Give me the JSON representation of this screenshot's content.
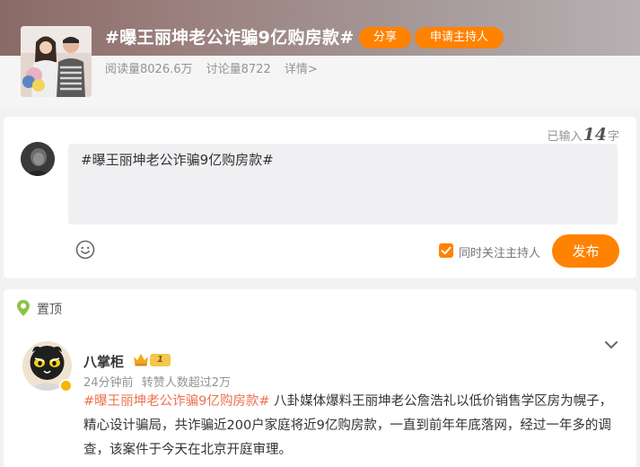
{
  "topic": {
    "title": "#曝王丽坤老公诈骗9亿购房款#",
    "share_label": "分享",
    "apply_host_label": "申请主持人",
    "read_count": "阅读量8026.6万",
    "discuss_count": "讨论量8722",
    "detail_link": "详情>"
  },
  "composer": {
    "char_count_prefix": "已输入",
    "char_count_value": "14",
    "char_count_suffix": "字",
    "input_value": "#曝王丽坤老公诈骗9亿购房款#",
    "follow_host_label": "同时关注主持人",
    "follow_host_checked": true,
    "publish_label": "发布"
  },
  "pinned_post": {
    "pin_label": "置顶",
    "author_name": "八掌柜",
    "level": "1",
    "time": "24分钟前",
    "repost_info": "转赞人数超过2万",
    "hashtag": "#曝王丽坤老公诈骗9亿购房款#",
    "body_text": " 八卦媒体爆料王丽坤老公詹浩礼以低价销售学区房为幌子，精心设计骗局，共诈骗近200户家庭将近9亿购房款，一直到前年年底落网，经过一年多的调查，该案件于今天在北京开庭审理。"
  },
  "colors": {
    "accent": "#ff8200",
    "hashtag": "#eb7350",
    "meta_text": "#939393"
  },
  "icons": [
    "emoji-icon",
    "checkbox-icon",
    "pin-icon",
    "crown-icon",
    "verified-icon",
    "chevron-down-icon"
  ]
}
